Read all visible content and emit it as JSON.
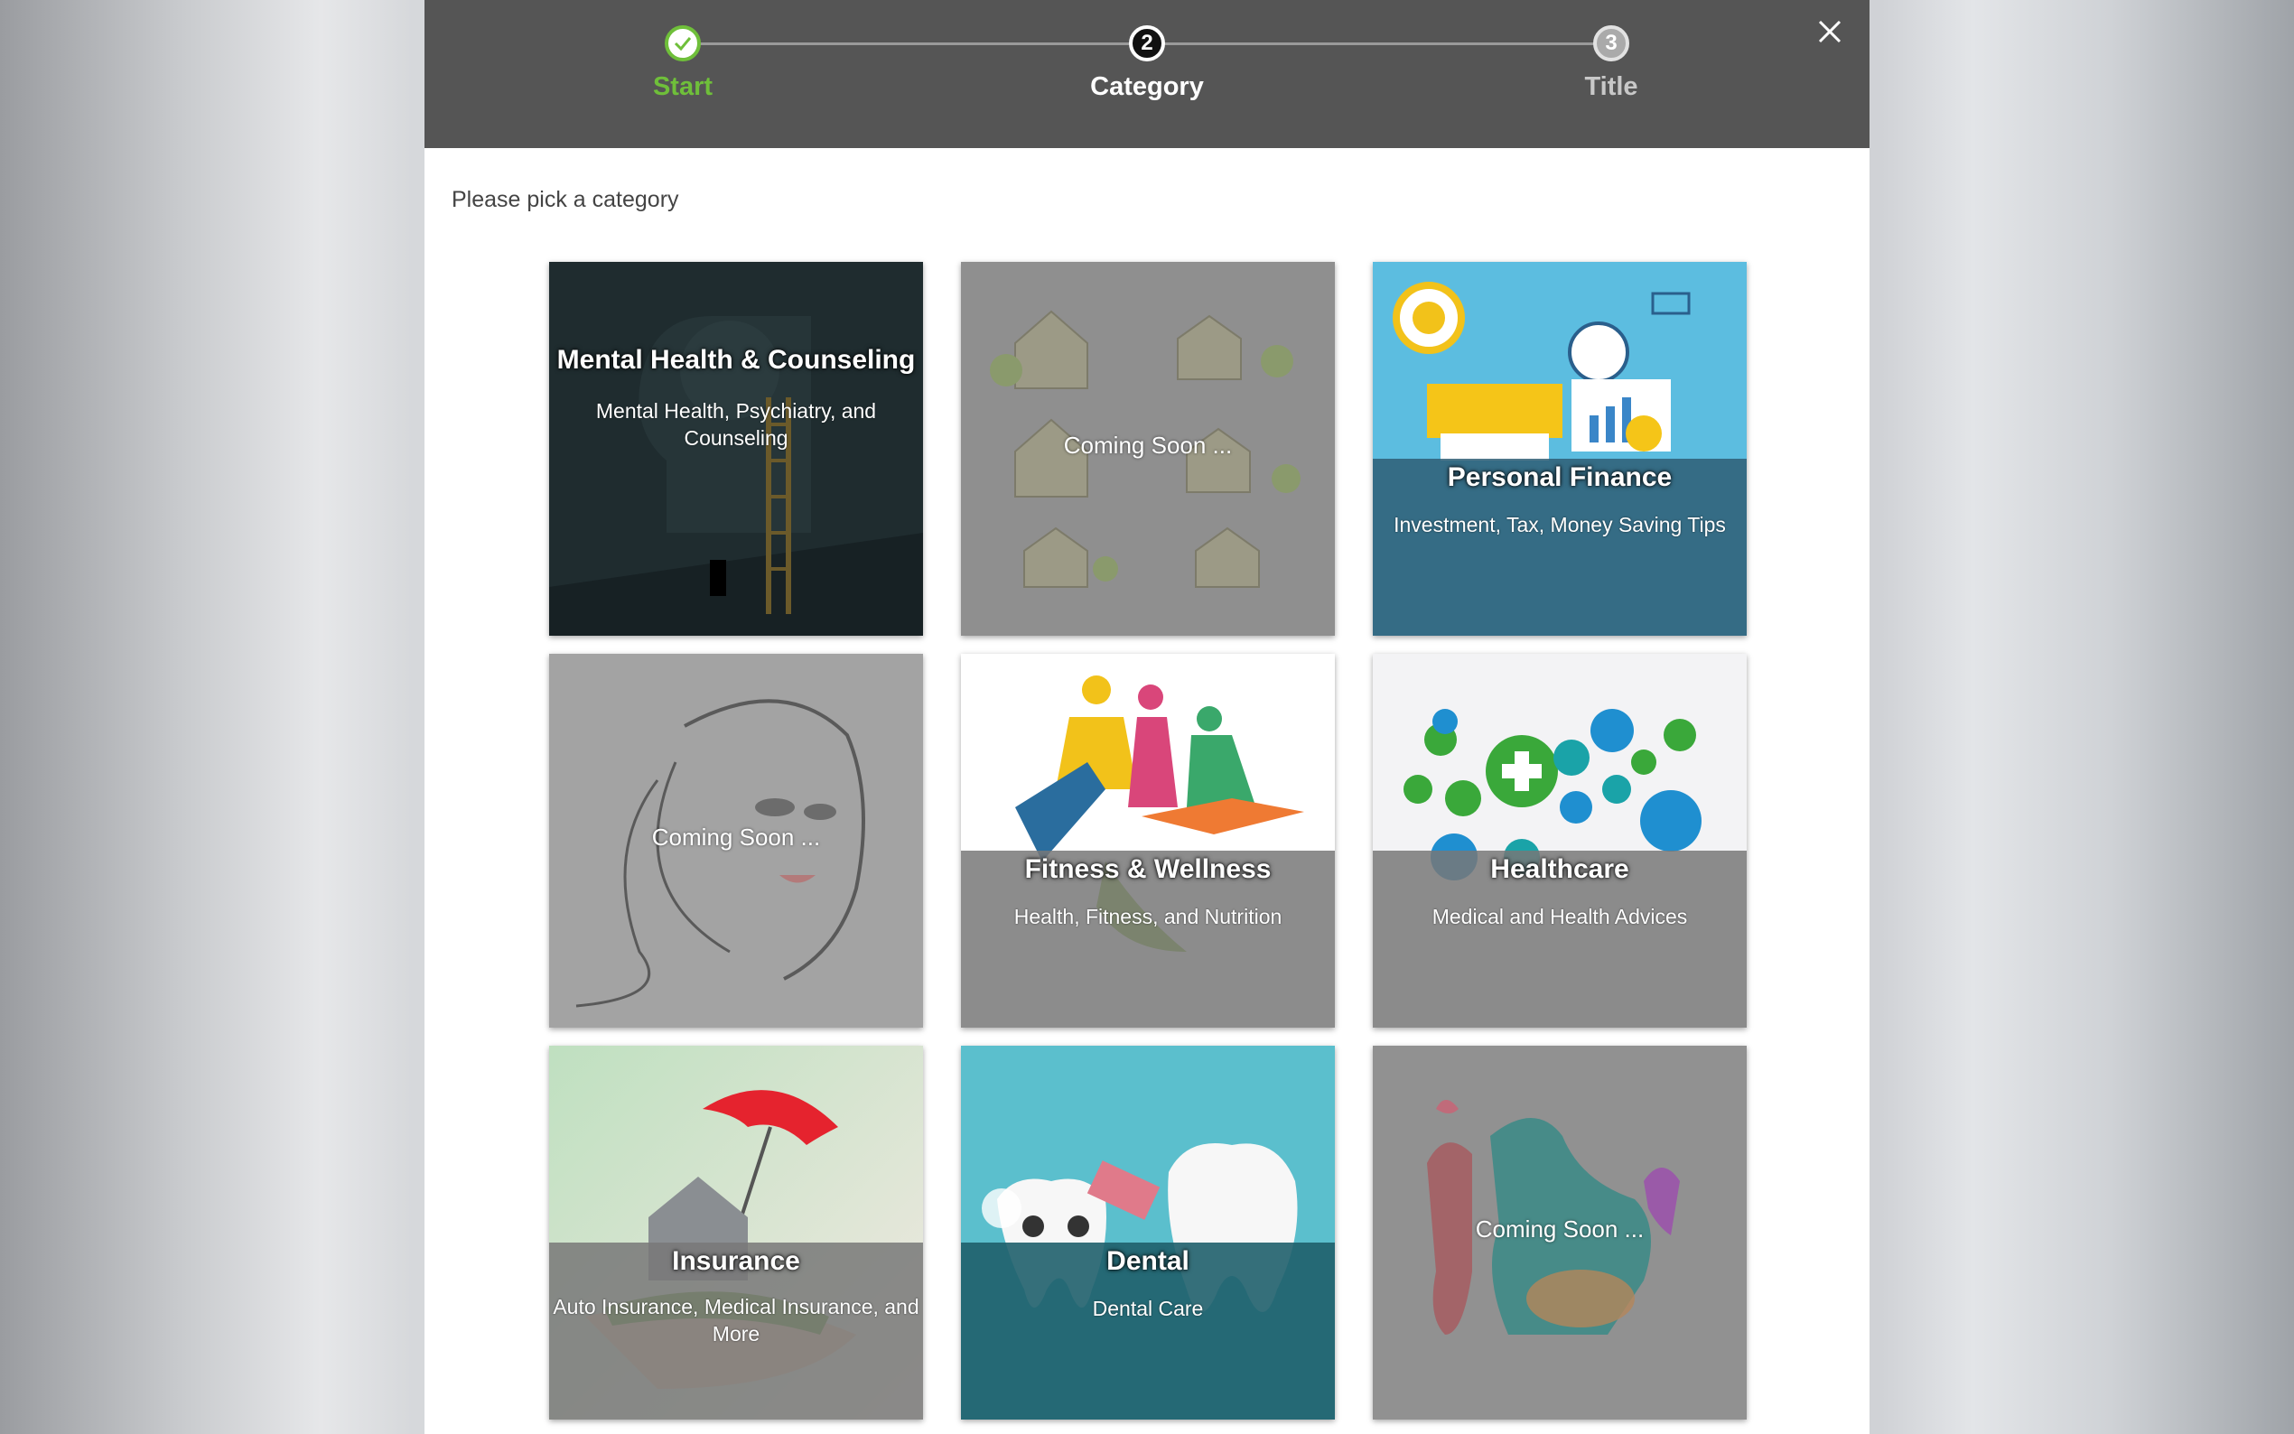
{
  "wizard": {
    "steps": [
      {
        "label": "Start",
        "state": "done",
        "marker": "check-icon"
      },
      {
        "label": "Category",
        "state": "active",
        "marker": "2"
      },
      {
        "label": "Title",
        "state": "todo",
        "marker": "3"
      }
    ],
    "close_icon": "close-icon"
  },
  "prompt": "Please pick a category",
  "categories": [
    {
      "title": "Mental Health & Counseling",
      "subtitle": "Mental Health, Psychiatry, and Counseling",
      "status": "available"
    },
    {
      "title": "",
      "subtitle": "",
      "status": "Coming Soon ..."
    },
    {
      "title": "Personal Finance",
      "subtitle": "Investment, Tax, Money Saving Tips",
      "status": "available"
    },
    {
      "title": "",
      "subtitle": "",
      "status": "Coming Soon ..."
    },
    {
      "title": "Fitness & Wellness",
      "subtitle": "Health, Fitness, and Nutrition",
      "status": "available"
    },
    {
      "title": "Healthcare",
      "subtitle": "Medical and Health Advices",
      "status": "available"
    },
    {
      "title": "Insurance",
      "subtitle": "Auto Insurance, Medical Insurance, and More",
      "status": "available"
    },
    {
      "title": "Dental",
      "subtitle": "Dental Care",
      "status": "available"
    },
    {
      "title": "",
      "subtitle": "",
      "status": "Coming Soon ..."
    }
  ],
  "colors": {
    "header_bg": "#555555",
    "done_green": "#6fbf3a",
    "finance_overlay": "#2e5e74",
    "dental_overlay": "#1f5f6b",
    "coming_soon_overlay": "#8e8e8e"
  }
}
